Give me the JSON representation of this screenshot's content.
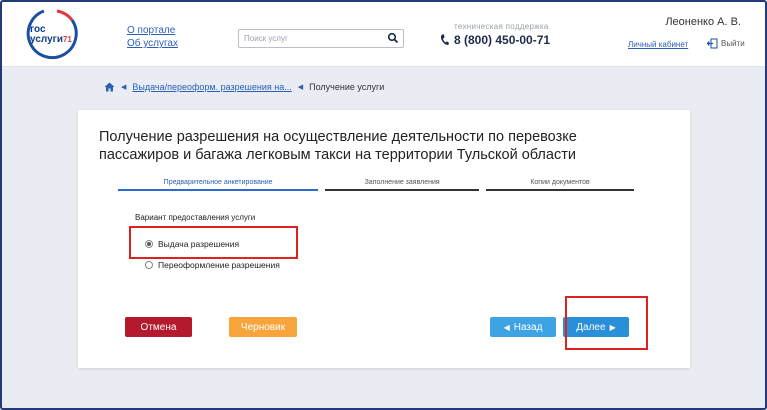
{
  "header": {
    "logo": {
      "line1": "гос",
      "line2": "услуги",
      "region": "71"
    },
    "links": [
      "О портале",
      "Об услугах"
    ],
    "search": {
      "placeholder": "Поиск услуг"
    },
    "support": {
      "label": "техническая поддержка",
      "phone": "8 (800) 450-00-71"
    },
    "user": {
      "name": "Леоненко А. В.",
      "cabinet": "Личный кабинет",
      "logout": "Выйти"
    }
  },
  "breadcrumb": {
    "link": "Выдача/переоформ. разрешения на...",
    "current": "Получение услуги"
  },
  "form": {
    "title_line1": "Получение разрешения на осуществление деятельности по перевозке",
    "title_line2": "пассажиров и багажа легковым такси на территории Тульской области",
    "steps": [
      "Предварительное анкетирование",
      "Заполнение заявления",
      "Копии документов"
    ],
    "variant_label": "Вариант предоставления услуги",
    "options": [
      "Выдача разрешения",
      "Переоформление разрешения"
    ],
    "selected_option": "Выдача разрешения",
    "buttons": {
      "cancel": "Отмена",
      "draft": "Черновик",
      "back": "Назад",
      "next": "Далее"
    }
  },
  "colors": {
    "accent": "#2a8fd9",
    "cancel": "#b5192d",
    "draft": "#f7a43a",
    "highlight": "#dd2222"
  }
}
